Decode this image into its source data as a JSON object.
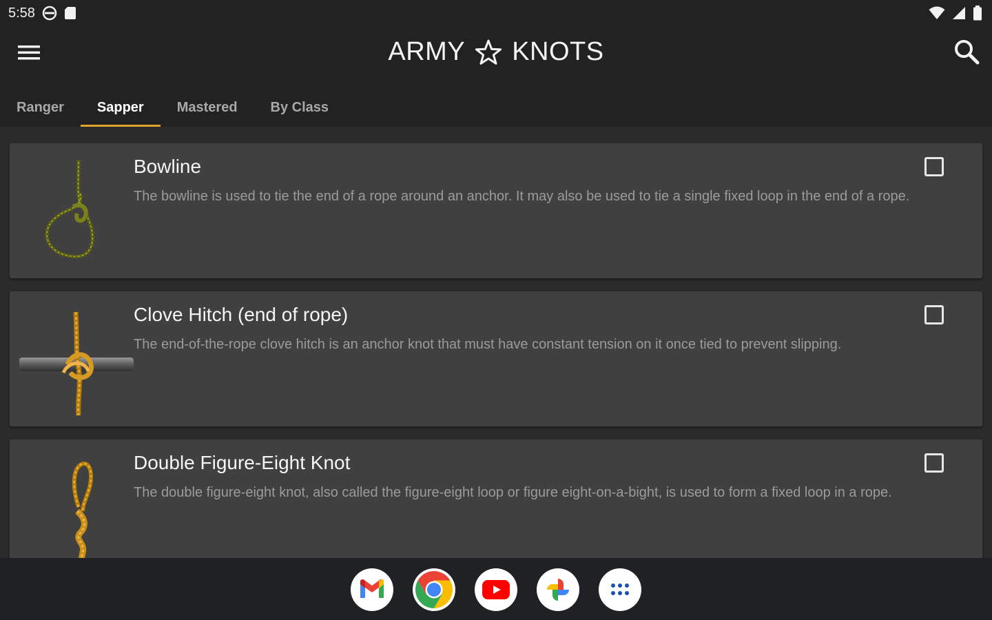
{
  "status_bar": {
    "time": "5:58",
    "left_icons": [
      "vpn-icon",
      "sd-card-icon"
    ],
    "right_icons": [
      "wifi-icon",
      "signal-icon",
      "battery-icon"
    ]
  },
  "app_bar": {
    "title_left": "ARMY",
    "title_right": "KNOTS",
    "title_icon": "star-outline-icon"
  },
  "tabs": [
    {
      "label": "Ranger",
      "active": false
    },
    {
      "label": "Sapper",
      "active": true
    },
    {
      "label": "Mastered",
      "active": false
    },
    {
      "label": "By Class",
      "active": false
    }
  ],
  "knots": [
    {
      "title": "Bowline",
      "description": "The bowline is used to tie the end of a rope around an anchor. It may also be used to tie a single fixed loop in the end of a rope.",
      "checked": false,
      "image_icon": "bowline-knot-image"
    },
    {
      "title": "Clove Hitch (end of rope)",
      "description": "The end-of-the-rope clove hitch is an anchor knot that must have constant tension on it once tied to prevent slipping.",
      "checked": false,
      "image_icon": "clove-hitch-knot-image"
    },
    {
      "title": "Double Figure-Eight Knot",
      "description": "The double figure-eight knot, also called the figure-eight loop or figure eight-on-a-bight, is used to form a fixed loop in a rope.",
      "checked": false,
      "image_icon": "figure-eight-knot-image"
    }
  ],
  "dock": [
    {
      "app": "gmail-icon"
    },
    {
      "app": "chrome-icon"
    },
    {
      "app": "youtube-icon"
    },
    {
      "app": "photos-icon"
    },
    {
      "app": "app-drawer-icon"
    }
  ],
  "colors": {
    "accent": "#e0a42a",
    "appbar_bg": "#222222",
    "card_bg": "#404040",
    "page_bg": "#2b2b2b"
  }
}
